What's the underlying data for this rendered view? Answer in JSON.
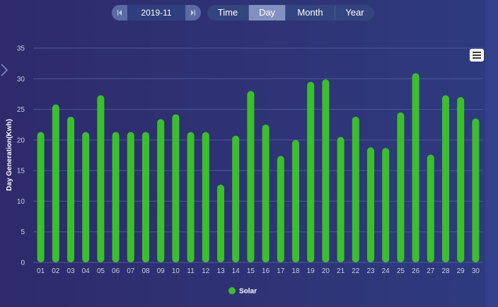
{
  "date_picker": {
    "value": "2019-11"
  },
  "tabs": [
    {
      "label": "Time",
      "active": false
    },
    {
      "label": "Day",
      "active": true
    },
    {
      "label": "Month",
      "active": false
    },
    {
      "label": "Year",
      "active": false
    }
  ],
  "colors": {
    "bar": "#3bbf2c",
    "grid": "#4c5899",
    "tick_text": "#c9cde0"
  },
  "icons": {
    "menu": "hamburger-menu-icon",
    "expand": "chevron-right-icon"
  },
  "chart_data": {
    "type": "bar",
    "title": "",
    "xlabel": "",
    "ylabel": "Day Generation(Kwh)",
    "ylim": [
      0,
      35
    ],
    "yticks": [
      0,
      5,
      10,
      15,
      20,
      25,
      30,
      35
    ],
    "grid": true,
    "legend_position": "bottom-center",
    "categories": [
      "01",
      "02",
      "03",
      "04",
      "05",
      "06",
      "07",
      "08",
      "09",
      "10",
      "11",
      "12",
      "13",
      "14",
      "15",
      "16",
      "17",
      "18",
      "19",
      "20",
      "21",
      "22",
      "23",
      "24",
      "25",
      "26",
      "27",
      "28",
      "29",
      "30"
    ],
    "series": [
      {
        "name": "Solar",
        "values": [
          21.3,
          25.8,
          23.8,
          21.3,
          27.3,
          21.3,
          21.3,
          21.3,
          23.4,
          24.2,
          21.3,
          21.3,
          12.7,
          20.7,
          28.0,
          22.5,
          17.4,
          20.0,
          29.5,
          29.9,
          20.5,
          23.8,
          18.8,
          18.7,
          24.5,
          30.9,
          17.6,
          27.3,
          27.0,
          23.5
        ]
      }
    ]
  }
}
